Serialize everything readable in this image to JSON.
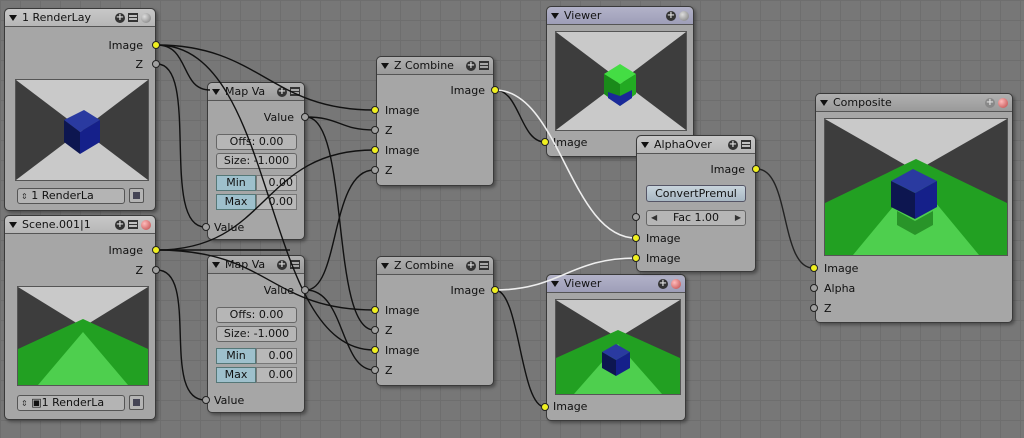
{
  "nodes": {
    "renderlayer1": {
      "title": "1 RenderLay",
      "out_image": "Image",
      "out_z": "Z",
      "scene_select": "1 RenderLa",
      "icons": [
        "plus-icon",
        "menu-icon",
        "ball-icon"
      ]
    },
    "scene001": {
      "title": "Scene.001|1",
      "out_image": "Image",
      "out_z": "Z",
      "scene_select": "1 RenderLa",
      "icons": [
        "plus-icon",
        "menu-icon",
        "ball-icon"
      ]
    },
    "mapvalue1": {
      "title": "Map Va",
      "out_value": "Value",
      "offs": "Offs: 0.00",
      "size": "Size: -1.000",
      "min_label": "Min",
      "min_value": "0.00",
      "max_label": "Max",
      "max_value": "0.00",
      "in_value": "Value"
    },
    "mapvalue2": {
      "title": "Map Va",
      "out_value": "Value",
      "offs": "Offs: 0.00",
      "size": "Size: -1.000",
      "min_label": "Min",
      "min_value": "0.00",
      "max_label": "Max",
      "max_value": "0.00",
      "in_value": "Value"
    },
    "zcombine1": {
      "title": "Z Combine",
      "out_image": "Image",
      "in_image1": "Image",
      "in_z1": "Z",
      "in_image2": "Image",
      "in_z2": "Z"
    },
    "zcombine2": {
      "title": "Z Combine",
      "out_image": "Image",
      "in_image1": "Image",
      "in_z1": "Z",
      "in_image2": "Image",
      "in_z2": "Z"
    },
    "viewer1": {
      "title": "Viewer",
      "in_image": "Image"
    },
    "viewer2": {
      "title": "Viewer",
      "in_image": "Image"
    },
    "alphaover": {
      "title": "AlphaOver",
      "out_image": "Image",
      "convert_btn": "ConvertPremul",
      "fac": "Fac 1.00",
      "in_image1": "Image",
      "in_image2": "Image"
    },
    "composite": {
      "title": "Composite",
      "in_image": "Image",
      "in_alpha": "Alpha",
      "in_z": "Z"
    }
  },
  "colors": {
    "background": "#777777",
    "node_body": "#a6a6a6",
    "socket_image": "#f0f020",
    "socket_value": "#a0a0a0",
    "wire": "#111111",
    "wire_active": "#ffffff"
  }
}
